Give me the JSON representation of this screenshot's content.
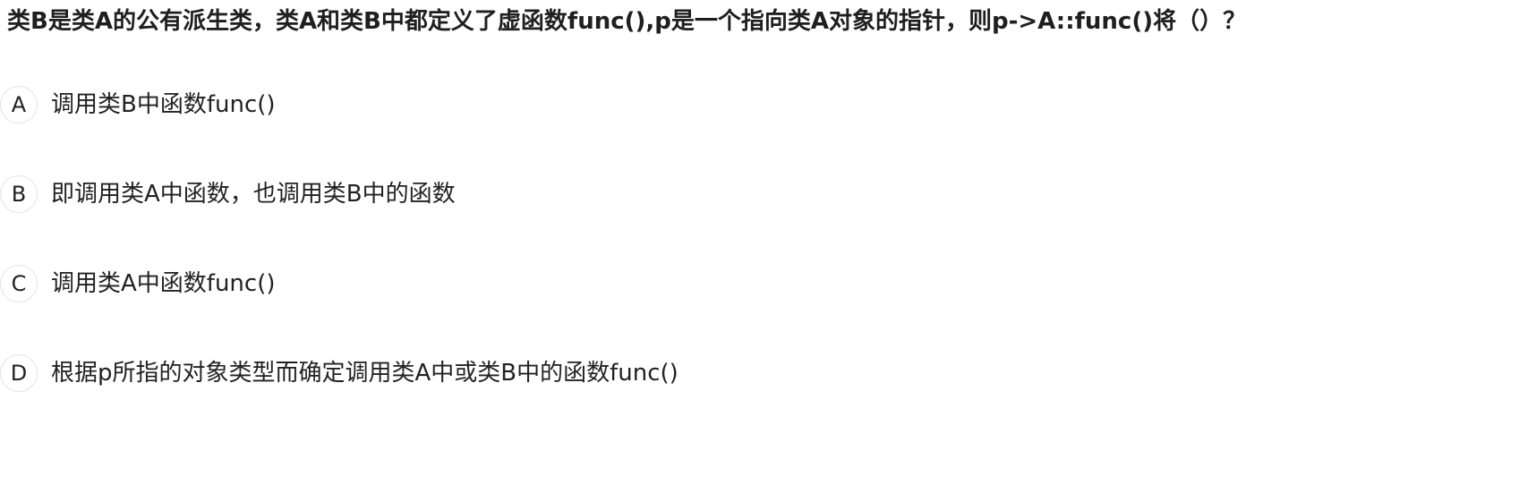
{
  "question": {
    "text": "类B是类A的公有派生类，类A和类B中都定义了虚函数func(),p是一个指向类A对象的指针，则p->A::func()将（）？"
  },
  "options": [
    {
      "letter": "A",
      "text": "调用类B中函数func()"
    },
    {
      "letter": "B",
      "text": "即调用类A中函数，也调用类B中的函数"
    },
    {
      "letter": "C",
      "text": "调用类A中函数func()"
    },
    {
      "letter": "D",
      "text": "根据p所指的对象类型而确定调用类A中或类B中的函数func()"
    }
  ]
}
